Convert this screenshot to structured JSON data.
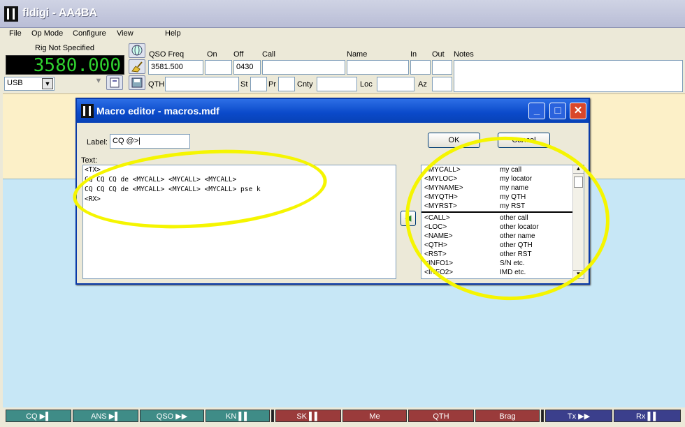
{
  "window": {
    "title": "fldigi - AA4BA"
  },
  "menu": [
    "File",
    "Op Mode",
    "Configure",
    "View",
    "Help"
  ],
  "rig": {
    "name": "Rig Not Specified",
    "frequency": "3580.000",
    "mode": "USB"
  },
  "qso": {
    "labels": {
      "qso_freq": "QSO Freq",
      "on": "On",
      "off": "Off",
      "call": "Call",
      "name": "Name",
      "in": "In",
      "out": "Out",
      "notes": "Notes",
      "qth": "QTH",
      "st": "St",
      "pr": "Pr",
      "cnty": "Cnty",
      "loc": "Loc",
      "az": "Az"
    },
    "values": {
      "qso_freq": "3581.500",
      "off": "0430"
    }
  },
  "dialog": {
    "title": "Macro editor - macros.mdf",
    "label_caption": "Label:",
    "label_value": "CQ @>|",
    "text_caption": "Text:",
    "text_lines": [
      "<TX>",
      "CQ CQ CQ de <MYCALL> <MYCALL> <MYCALL>",
      "CQ CQ CQ de <MYCALL> <MYCALL> <MYCALL> pse k",
      "<RX>"
    ],
    "ok_label": "OK",
    "cancel_label": "Cancel",
    "tags_group1": [
      {
        "tag": "<MYCALL>",
        "desc": "my call"
      },
      {
        "tag": "<MYLOC>",
        "desc": "my locator"
      },
      {
        "tag": "<MYNAME>",
        "desc": "my name"
      },
      {
        "tag": "<MYQTH>",
        "desc": "my QTH"
      },
      {
        "tag": "<MYRST>",
        "desc": "my RST"
      }
    ],
    "tags_group2": [
      {
        "tag": "<CALL>",
        "desc": "other call"
      },
      {
        "tag": "<LOC>",
        "desc": "other locator"
      },
      {
        "tag": "<NAME>",
        "desc": "other name"
      },
      {
        "tag": "<QTH>",
        "desc": "other QTH"
      },
      {
        "tag": "<RST>",
        "desc": "other RST"
      },
      {
        "tag": "<INFO1>",
        "desc": "S/N etc."
      },
      {
        "tag": "<INFO2>",
        "desc": "IMD etc."
      }
    ]
  },
  "macros": [
    {
      "label": "CQ ▶▌",
      "color": "teal"
    },
    {
      "label": "ANS ▶▌",
      "color": "teal"
    },
    {
      "label": "QSO ▶▶",
      "color": "teal"
    },
    {
      "label": "KN ▌▌",
      "color": "teal"
    },
    {
      "label": "SK ▌▌",
      "color": "red"
    },
    {
      "label": "Me",
      "color": "red"
    },
    {
      "label": "QTH",
      "color": "red"
    },
    {
      "label": "Brag",
      "color": "red"
    },
    {
      "label": "Tx ▶▶",
      "color": "navy"
    },
    {
      "label": "Rx ▌▌",
      "color": "navy"
    }
  ],
  "colors": {
    "highlight": "#f5f500",
    "rx_bg": "#fcf0c8",
    "tx_bg": "#c7e7f6",
    "freq_fg": "#2fd22f"
  }
}
